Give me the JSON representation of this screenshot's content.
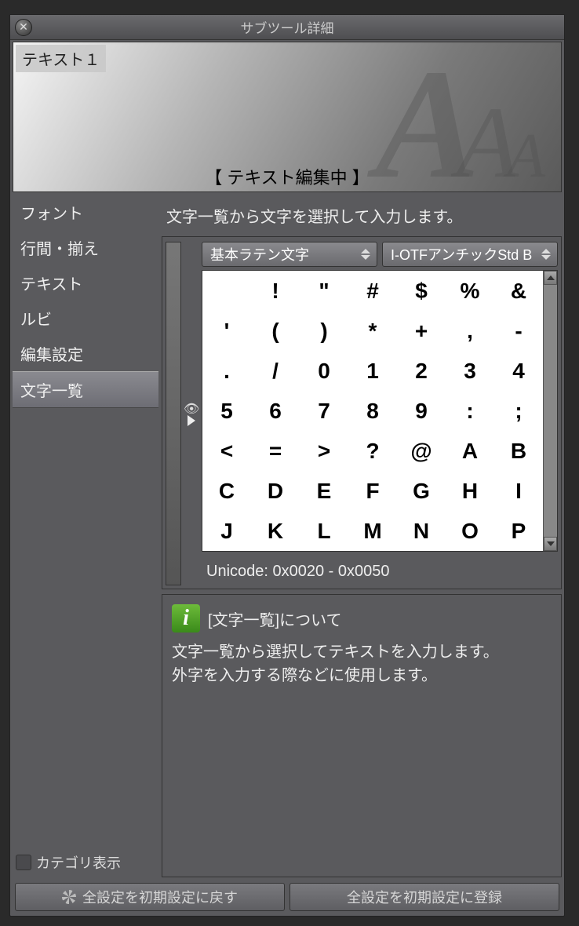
{
  "window": {
    "title": "サブツール詳細"
  },
  "preview": {
    "name": "テキスト１",
    "status": "【 テキスト編集中 】"
  },
  "sidebar": {
    "items": [
      {
        "label": "フォント"
      },
      {
        "label": "行間・揃え"
      },
      {
        "label": "テキスト"
      },
      {
        "label": "ルビ"
      },
      {
        "label": "編集設定"
      },
      {
        "label": "文字一覧"
      }
    ],
    "selected_index": 5,
    "category_toggle_label": "カテゴリ表示"
  },
  "main": {
    "instruction": "文字一覧から文字を選択して入力します。",
    "charset_dropdown": "基本ラテン文字",
    "font_dropdown": "I-OTFアンチックStd B",
    "unicode_range": "Unicode: 0x0020 - 0x0050",
    "chars": [
      "",
      "!",
      "\"",
      "#",
      "$",
      "%",
      "&",
      "'",
      "(",
      ")",
      "*",
      "+",
      ",",
      "-",
      ".",
      "/",
      "0",
      "1",
      "2",
      "3",
      "4",
      "5",
      "6",
      "7",
      "8",
      "9",
      ":",
      ";",
      "<",
      "=",
      ">",
      "?",
      "@",
      "A",
      "B",
      "C",
      "D",
      "E",
      "F",
      "G",
      "H",
      "I",
      "J",
      "K",
      "L",
      "M",
      "N",
      "O",
      "P"
    ]
  },
  "info": {
    "title": "[文字一覧]について",
    "body1": "文字一覧から選択してテキストを入力します。",
    "body2": "外字を入力する際などに使用します。"
  },
  "footer": {
    "reset_label": "全設定を初期設定に戻す",
    "register_label": "全設定を初期設定に登録"
  }
}
